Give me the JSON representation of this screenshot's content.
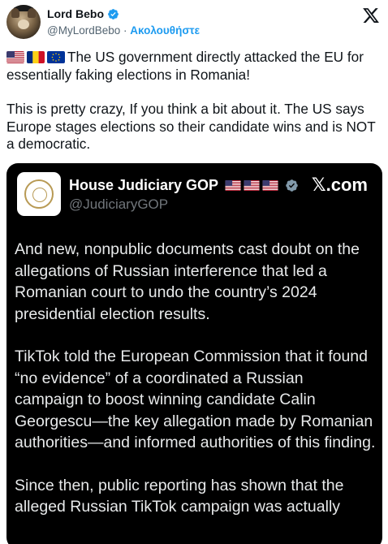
{
  "author": {
    "display_name": "Lord Bebo",
    "handle": "@MyLordBebo",
    "separator": " · ",
    "follow_label": "Ακολουθήστε"
  },
  "flags": [
    "us-flag",
    "romania-flag",
    "eu-flag"
  ],
  "tweet": {
    "paragraph_1": "The US government directly attacked the EU for essentially faking elections in Romania!",
    "paragraph_2": "This is pretty crazy, If you think a bit about it. The US says Europe stages elections so their candidate wins and is NOT a democratic."
  },
  "quoted_card": {
    "display_name": "House Judiciary GOP",
    "handle": "@JudiciaryGOP",
    "brand": "𝕏.com",
    "paragraph_1": "And new, nonpublic documents cast doubt on the allegations of Russian interference that led a Romanian court to undo the country’s 2024 presidential election results.",
    "paragraph_2": "TikTok told the European Commission that it found “no evidence” of a coordinated a Russian campaign to boost winning candidate Calin Georgescu—the key allegation made by Romanian authorities—and informed authorities of this finding.",
    "paragraph_3": "Since then, public reporting has shown that the alleged Russian TikTok campaign was actually"
  },
  "colors": {
    "link": "#1d9bf0",
    "verified": "#1d9bf0",
    "card_background": "#000000",
    "secondary_text": "#536471"
  }
}
